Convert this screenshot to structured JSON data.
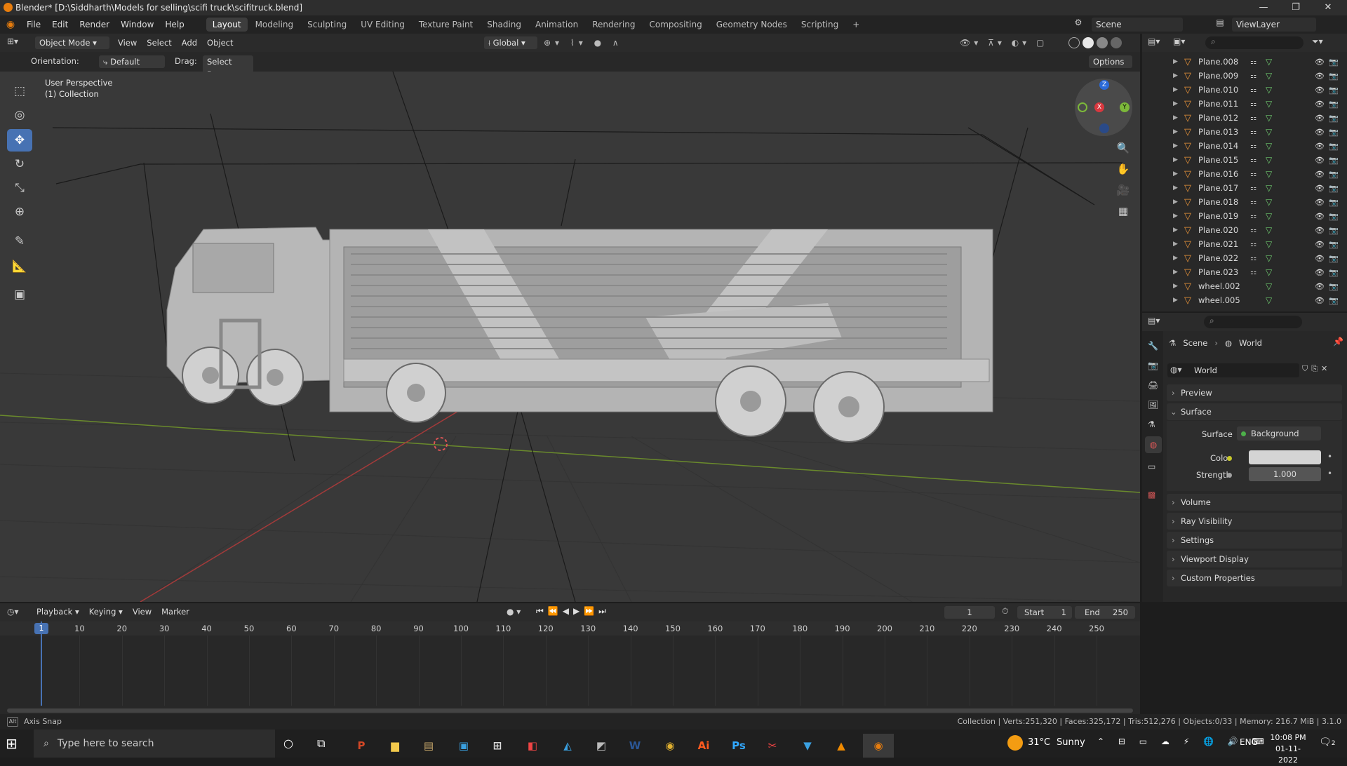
{
  "window": {
    "title": "Blender* [D:\\Siddharth\\Models for selling\\scifi truck\\scifitruck.blend]",
    "minimize": "—",
    "maximize": "❐",
    "close": "✕"
  },
  "menus": [
    "File",
    "Edit",
    "Render",
    "Window",
    "Help"
  ],
  "workspaces": [
    "Layout",
    "Modeling",
    "Sculpting",
    "UV Editing",
    "Texture Paint",
    "Shading",
    "Animation",
    "Rendering",
    "Compositing",
    "Geometry Nodes",
    "Scripting"
  ],
  "scene": {
    "label": "Scene",
    "view_layer": "ViewLayer"
  },
  "viewport_header": {
    "mode": "Object Mode",
    "menus": [
      "View",
      "Select",
      "Add",
      "Object"
    ],
    "transform_orientation": "Global"
  },
  "tool_settings": {
    "orientation_label": "Orientation:",
    "orientation_value": "Default",
    "drag_label": "Drag:",
    "drag_value": "Select Box",
    "options": "Options"
  },
  "viewport": {
    "perspective": "User Perspective",
    "collection": "(1) Collection"
  },
  "gizmo": {
    "z": "Z",
    "y": "Y",
    "x": "X"
  },
  "outliner": {
    "items": [
      "Plane.008",
      "Plane.009",
      "Plane.010",
      "Plane.011",
      "Plane.012",
      "Plane.013",
      "Plane.014",
      "Plane.015",
      "Plane.016",
      "Plane.017",
      "Plane.018",
      "Plane.019",
      "Plane.020",
      "Plane.021",
      "Plane.022",
      "Plane.023",
      "wheel.002",
      "wheel.005"
    ]
  },
  "properties": {
    "breadcrumb": [
      "Scene",
      "World"
    ],
    "world_name": "World",
    "panels": {
      "preview": "Preview",
      "surface": "Surface"
    },
    "surface": {
      "label": "Surface",
      "value": "Background"
    },
    "color_label": "Color",
    "color_value": "#d4d4d4",
    "strength_label": "Strength",
    "strength_value": "1.000",
    "collapsed_panels": [
      "Volume",
      "Ray Visibility",
      "Settings",
      "Viewport Display",
      "Custom Properties"
    ]
  },
  "timeline": {
    "menus": [
      "Playback",
      "Keying",
      "View",
      "Marker"
    ],
    "current_frame": "1",
    "start_label": "Start",
    "start": "1",
    "end_label": "End",
    "end": "250",
    "ticks": [
      "1",
      "10",
      "20",
      "30",
      "40",
      "50",
      "60",
      "70",
      "80",
      "90",
      "100",
      "110",
      "120",
      "130",
      "140",
      "150",
      "160",
      "170",
      "180",
      "190",
      "200",
      "210",
      "220",
      "230",
      "240",
      "250"
    ]
  },
  "status": {
    "left": "Axis Snap",
    "right": "Collection | Verts:251,320 | Faces:325,172 | Tris:512,276 | Objects:0/33 | Memory: 216.7 MiB | 3.1.0"
  },
  "taskbar": {
    "search_placeholder": "Type here to search",
    "weather_temp": "31°C",
    "weather_text": "Sunny",
    "lang": "ENG",
    "time": "10:08 PM",
    "date": "01-11-2022",
    "notifications": "2"
  },
  "colors": {
    "accent": "#4772b3",
    "orange": "#e87d0d",
    "grid_x": "#a33a3a",
    "grid_y": "#6a8a2c"
  }
}
